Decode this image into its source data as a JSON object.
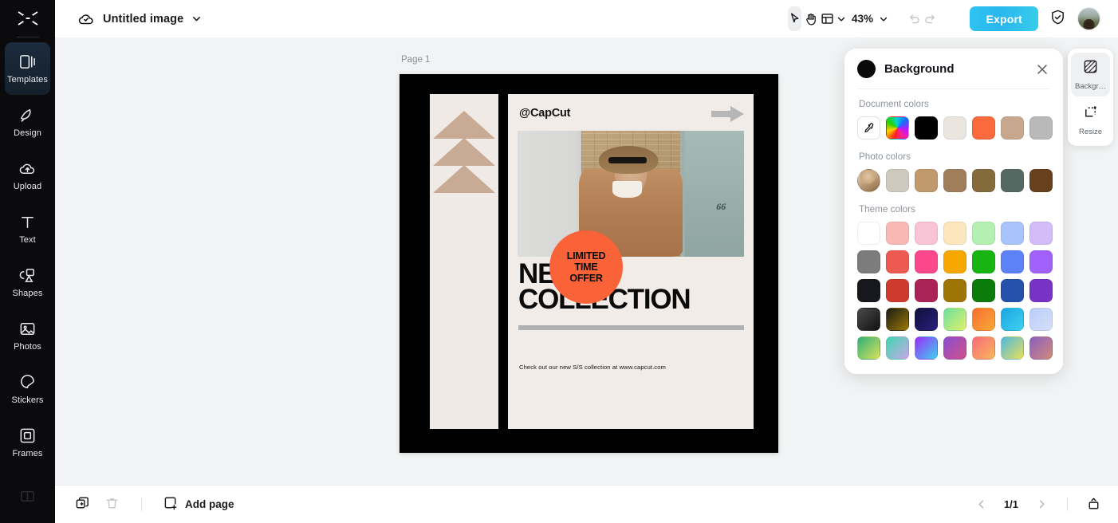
{
  "app": {
    "logo_icon": "capcut-logo-icon"
  },
  "sidebar": {
    "items": [
      {
        "label": "Templates",
        "icon": "templates-icon",
        "active": true
      },
      {
        "label": "Design",
        "icon": "design-icon",
        "active": false
      },
      {
        "label": "Upload",
        "icon": "upload-cloud-icon",
        "active": false
      },
      {
        "label": "Text",
        "icon": "text-icon",
        "active": false
      },
      {
        "label": "Shapes",
        "icon": "shapes-icon",
        "active": false
      },
      {
        "label": "Photos",
        "icon": "photos-icon",
        "active": false
      },
      {
        "label": "Stickers",
        "icon": "stickers-icon",
        "active": false
      },
      {
        "label": "Frames",
        "icon": "frames-icon",
        "active": false
      }
    ]
  },
  "topbar": {
    "cloud_icon": "cloud-saved-icon",
    "document_title": "Untitled image",
    "title_chevron_icon": "chevron-down-icon",
    "select_tool_icon": "cursor-select-icon",
    "hand_tool_icon": "hand-pan-icon",
    "layout_tool_icon": "layout-grid-icon",
    "layout_chevron_icon": "chevron-down-icon",
    "zoom_level": "43%",
    "zoom_chevron_icon": "chevron-down-icon",
    "undo_icon": "undo-icon",
    "redo_icon": "redo-icon",
    "export_label": "Export",
    "shield_icon": "shield-check-icon",
    "avatar": "user-avatar"
  },
  "canvas": {
    "page_label": "Page 1",
    "poster": {
      "handle": "@CapCut",
      "arrow_icon": "right-arrow-shape",
      "title_line1": "NEW",
      "title_line2": "COLLECTION",
      "footer": "Check out our new S/S collection at www.capcut.com",
      "badge_line1": "LIMITED",
      "badge_line2": "TIME",
      "badge_line3": "OFFER",
      "badge_color": "#fa6238",
      "frame_color": "#000000",
      "paper_color": "#f2ece8",
      "strip_color": "#efeae5",
      "triangle_color": "#c9ab95",
      "house_number": "66"
    }
  },
  "background_panel": {
    "title": "Background",
    "close_icon": "close-icon",
    "current_color": "#0a0a0a",
    "sections": [
      {
        "label": "Document colors",
        "swatches": [
          {
            "type": "picker",
            "icon": "eyedropper-icon",
            "color": "#ffffff"
          },
          {
            "type": "rainbow",
            "color": "rainbow"
          },
          {
            "type": "color",
            "color": "#000000"
          },
          {
            "type": "color",
            "color": "#eae5de"
          },
          {
            "type": "color",
            "color": "#fb6a3c"
          },
          {
            "type": "color",
            "color": "#c7a88e"
          },
          {
            "type": "color",
            "color": "#b9b9b9"
          }
        ]
      },
      {
        "label": "Photo colors",
        "swatches": [
          {
            "type": "photo",
            "color": "photo-thumb"
          },
          {
            "type": "color",
            "color": "#cdc9bf"
          },
          {
            "type": "color",
            "color": "#c09a6d"
          },
          {
            "type": "color",
            "color": "#a07e5c"
          },
          {
            "type": "color",
            "color": "#856b3c"
          },
          {
            "type": "color",
            "color": "#556861"
          },
          {
            "type": "color",
            "color": "#67401e"
          }
        ]
      },
      {
        "label": "Theme colors",
        "swatches": [
          {
            "type": "color",
            "color": "#ffffff"
          },
          {
            "type": "color",
            "color": "#f8b9b4"
          },
          {
            "type": "color",
            "color": "#f9c3d6"
          },
          {
            "type": "color",
            "color": "#fbe6bd"
          },
          {
            "type": "color",
            "color": "#b4f0b2"
          },
          {
            "type": "color",
            "color": "#a9c4fb"
          },
          {
            "type": "color",
            "color": "#d2bdf8"
          },
          {
            "type": "color",
            "color": "#7c7c7c"
          },
          {
            "type": "color",
            "color": "#ed5a52"
          },
          {
            "type": "color",
            "color": "#fb478c"
          },
          {
            "type": "color",
            "color": "#f7a800"
          },
          {
            "type": "color",
            "color": "#18b512"
          },
          {
            "type": "color",
            "color": "#5d82f8"
          },
          {
            "type": "color",
            "color": "#a062fb"
          },
          {
            "type": "color",
            "color": "#17181d"
          },
          {
            "type": "color",
            "color": "#ce3a2e"
          },
          {
            "type": "color",
            "color": "#ab2356"
          },
          {
            "type": "color",
            "color": "#9d7405"
          },
          {
            "type": "color",
            "color": "#0b7b09"
          },
          {
            "type": "color",
            "color": "#2452ab"
          },
          {
            "type": "color",
            "color": "#7833c4"
          },
          {
            "type": "gradient",
            "color": "linear-gradient(135deg,#4a4a4a,#111113)"
          },
          {
            "type": "gradient",
            "color": "linear-gradient(135deg,#1b1a14,#9a7a06)"
          },
          {
            "type": "gradient",
            "color": "linear-gradient(135deg,#10103a,#2a1f7e)"
          },
          {
            "type": "gradient",
            "color": "linear-gradient(135deg,#6ce0a0,#e0f06a)"
          },
          {
            "type": "gradient",
            "color": "linear-gradient(135deg,#f76e2e,#f9a93a)"
          },
          {
            "type": "gradient",
            "color": "linear-gradient(135deg,#1aa7e0,#3fd0f0)"
          },
          {
            "type": "gradient",
            "color": "linear-gradient(135deg,#b9cdfb,#d6def8)"
          },
          {
            "type": "gradient",
            "color": "linear-gradient(135deg,#2fae7a,#d9e35a)"
          },
          {
            "type": "gradient",
            "color": "linear-gradient(135deg,#3fd8b0,#c9a6e8)"
          },
          {
            "type": "gradient",
            "color": "linear-gradient(135deg,#9a2ef8,#3fd0f0)"
          },
          {
            "type": "gradient",
            "color": "linear-gradient(135deg,#8a4fd0,#d0508a)"
          },
          {
            "type": "gradient",
            "color": "linear-gradient(135deg,#fb6a7a,#f7b85a)"
          },
          {
            "type": "gradient",
            "color": "linear-gradient(135deg,#4fb8e0,#e8e05a)"
          },
          {
            "type": "gradient",
            "color": "linear-gradient(135deg,#8a5fc0,#d08a7a)"
          }
        ]
      }
    ]
  },
  "right_rail": {
    "items": [
      {
        "label": "Backgr…",
        "icon": "background-icon",
        "active": true
      },
      {
        "label": "Resize",
        "icon": "resize-icon",
        "active": false
      }
    ]
  },
  "bottombar": {
    "duplicate_icon": "duplicate-page-icon",
    "delete_icon": "trash-icon",
    "add_page_icon": "add-page-icon",
    "add_page_label": "Add page",
    "prev_icon": "chevron-left-icon",
    "page_indicator": "1/1",
    "next_icon": "chevron-right-icon",
    "grid_view_icon": "page-preview-icon"
  }
}
